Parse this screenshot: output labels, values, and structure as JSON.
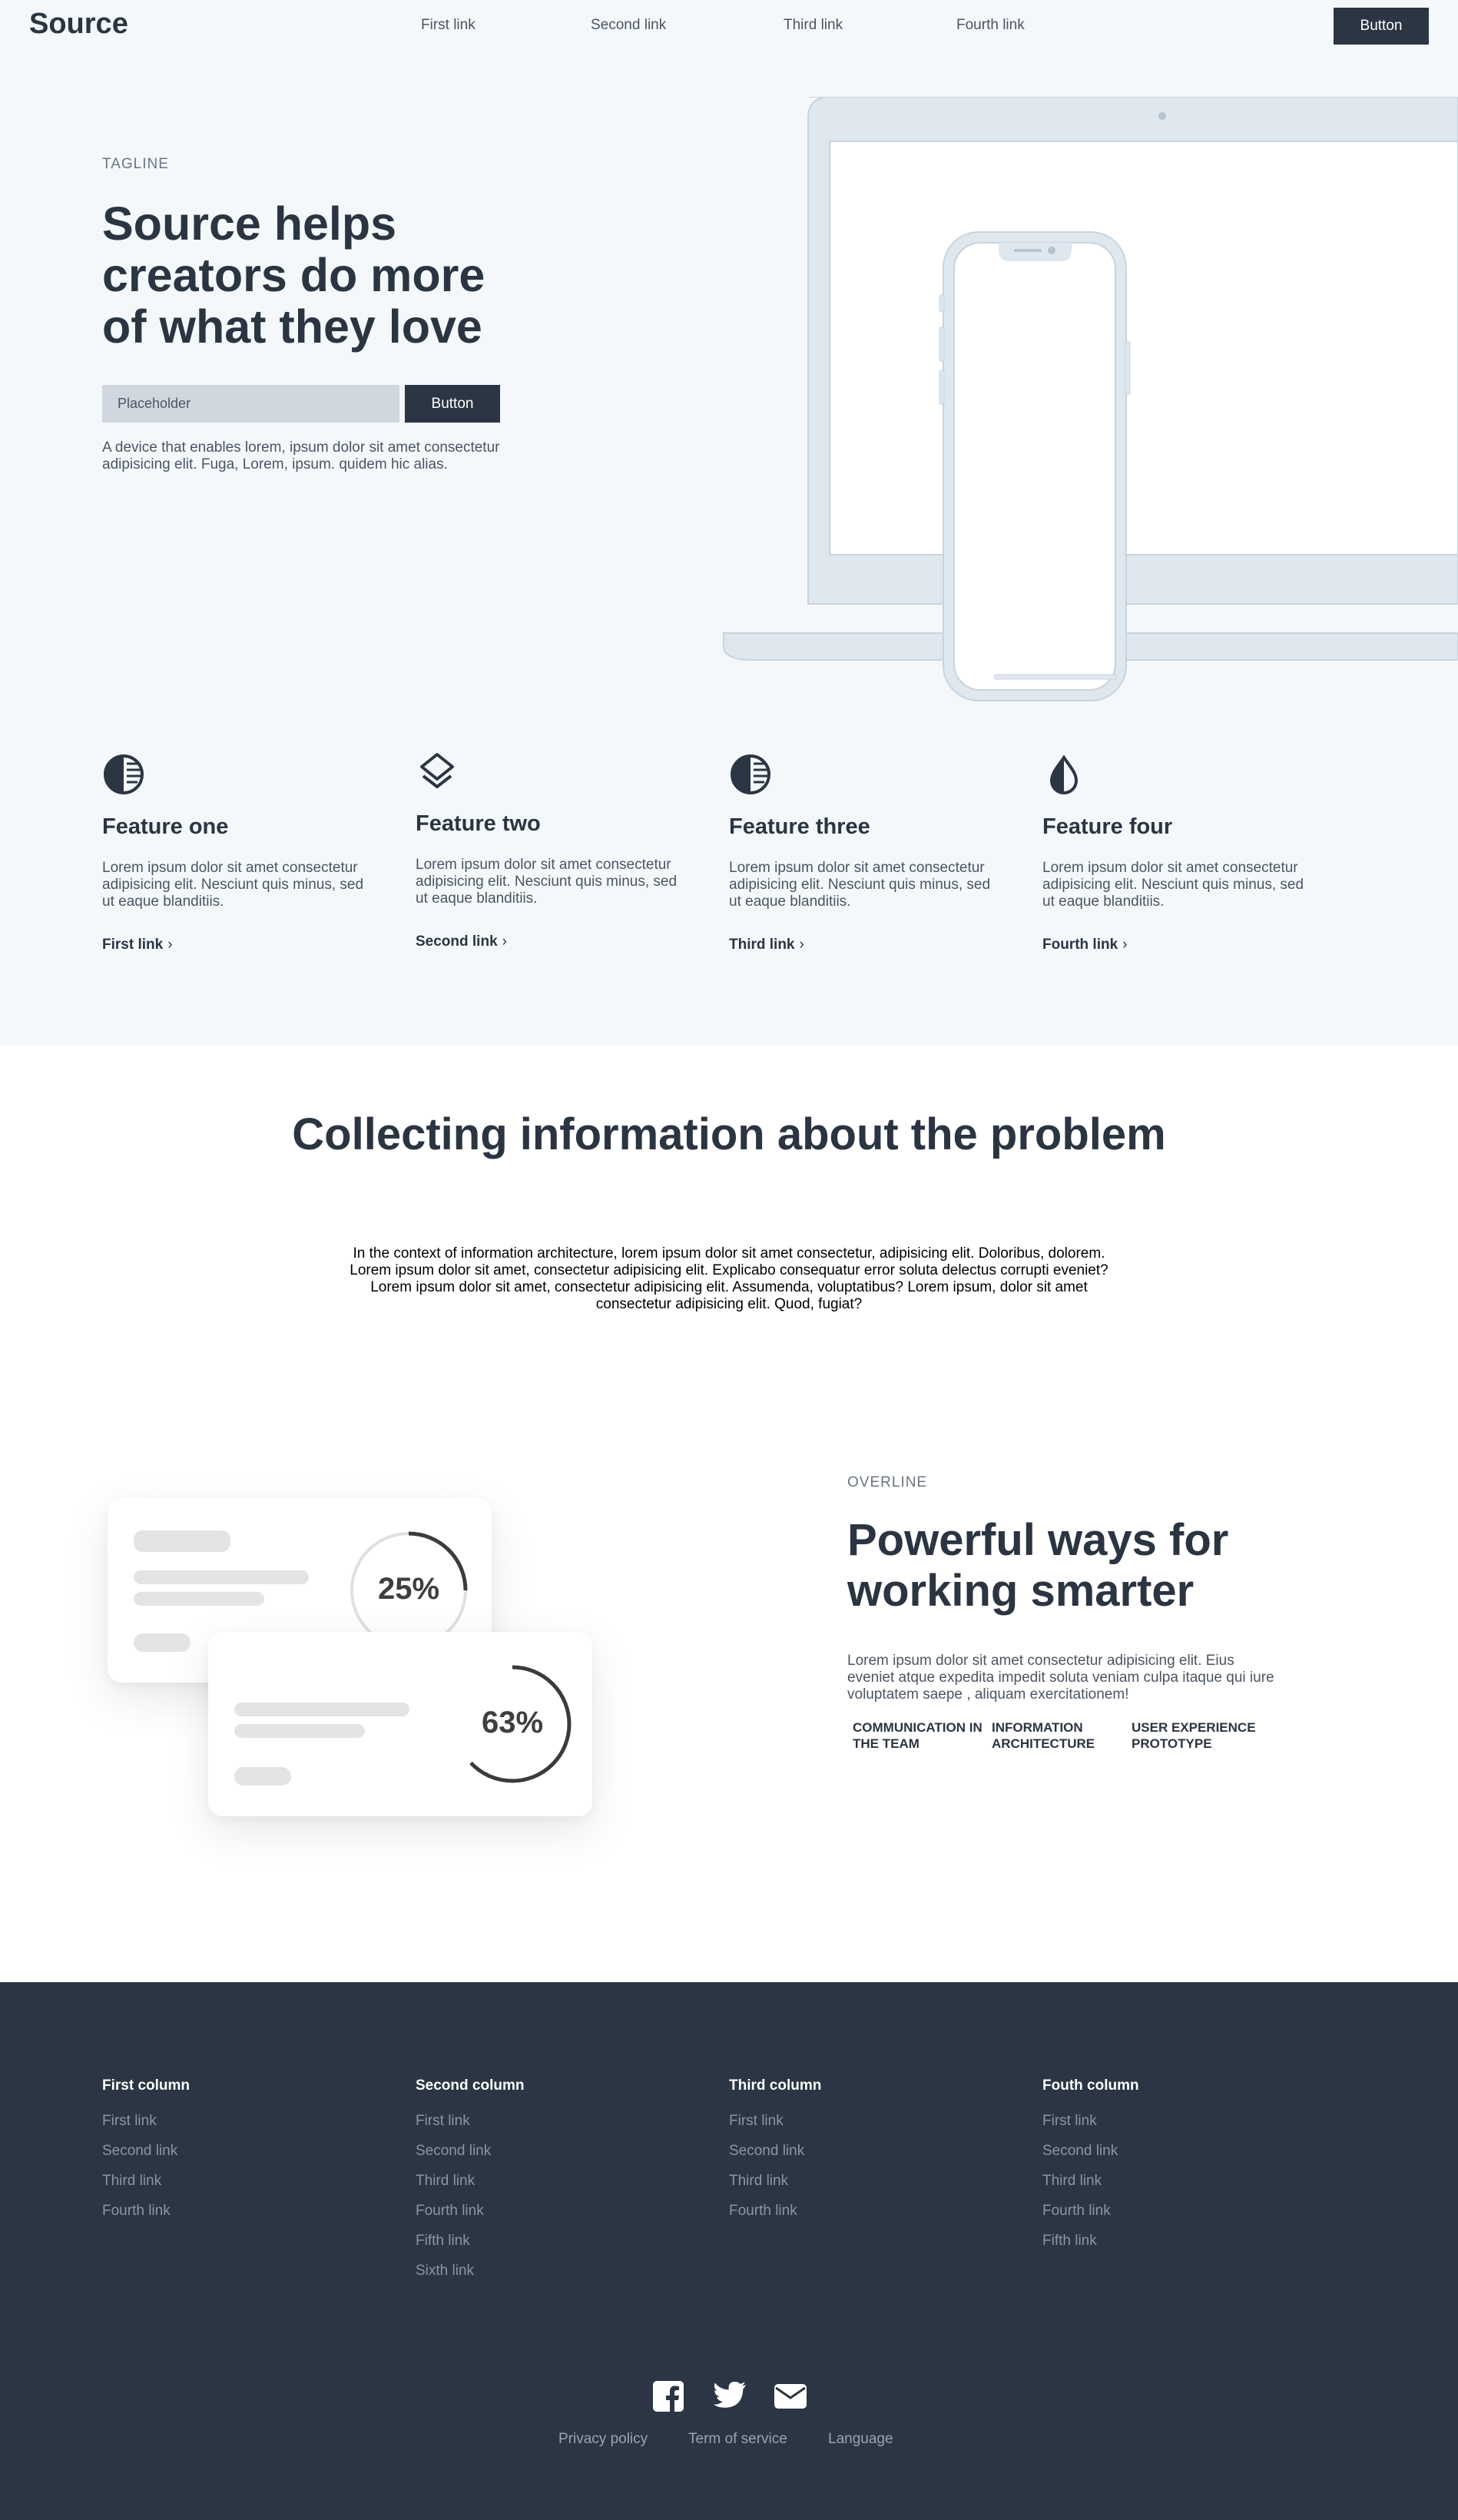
{
  "nav": {
    "logo": "Source",
    "links": [
      "First link",
      "Second link",
      "Third link",
      "Fourth link"
    ],
    "button": "Button"
  },
  "hero": {
    "tagline": "TAGLINE",
    "title": "Source helps creators do more of what they love",
    "input_placeholder": "Placeholder",
    "button": "Button",
    "description": "A device that enables lorem, ipsum dolor sit amet consectetur adipisicing elit. Fuga, Lorem, ipsum. quidem hic alias."
  },
  "features": [
    {
      "icon": "contrast-circle-icon",
      "title": "Feature one",
      "text": "Lorem ipsum dolor sit amet consectetur adipisicing elit. Nesciunt quis minus, sed ut eaque blanditiis.",
      "link": "First link"
    },
    {
      "icon": "layers-icon",
      "title": "Feature two",
      "text": "Lorem ipsum dolor sit amet consectetur adipisicing elit. Nesciunt quis minus, sed ut eaque blanditiis.",
      "link": "Second link"
    },
    {
      "icon": "contrast-circle-icon",
      "title": "Feature three",
      "text": "Lorem ipsum dolor sit amet consectetur adipisicing elit. Nesciunt quis minus, sed ut eaque blanditiis.",
      "link": "Third link"
    },
    {
      "icon": "drop-half-icon",
      "title": "Feature four",
      "text": "Lorem ipsum dolor sit amet consectetur adipisicing elit. Nesciunt quis minus, sed ut eaque blanditiis.",
      "link": "Fourth link"
    }
  ],
  "collect": {
    "title": "Collecting information about the problem",
    "text": "In the context of information architecture, lorem ipsum dolor sit amet consectetur, adipisicing elit. Doloribus, dolorem. Lorem ipsum dolor sit amet, consectetur adipisicing elit. Explicabo consequatur error soluta delectus corrupti eveniet? Lorem ipsum dolor sit amet, consectetur adipisicing elit. Assumenda, voluptatibus? Lorem ipsum, dolor sit amet consectetur adipisicing elit. Quod, fugiat?"
  },
  "power": {
    "overline": "OVERLINE",
    "title": "Powerful ways for working smarter",
    "text": "Lorem ipsum dolor sit amet consectetur adipisicing elit. Eius eveniet atque expedita impedit soluta veniam culpa itaque qui iure voluptatem saepe , aliquam exercitationem!",
    "tags": [
      "COMMUNICATION IN THE TEAM",
      "INFORMATION ARCHITECTURE",
      "USER EXPERIENCE PROTOTYPE"
    ],
    "cards": [
      {
        "label": "25%",
        "progress": 0.25
      },
      {
        "label": "63%",
        "progress": 0.63
      }
    ]
  },
  "footer": {
    "columns": [
      {
        "title": "First column",
        "links": [
          "First link",
          "Second link",
          "Third link",
          "Fourth link"
        ]
      },
      {
        "title": "Second column",
        "links": [
          "First link",
          "Second link",
          "Third link",
          "Fourth link",
          "Fifth link",
          "Sixth link"
        ]
      },
      {
        "title": "Third column",
        "links": [
          "First link",
          "Second link",
          "Third link",
          "Fourth link"
        ]
      },
      {
        "title": "Fouth column",
        "links": [
          "First link",
          "Second link",
          "Third link",
          "Fourth link",
          "Fifth link"
        ]
      }
    ],
    "social": [
      "facebook-icon",
      "twitter-icon",
      "mail-icon"
    ],
    "legal": [
      "Privacy policy",
      "Term of service",
      "Language"
    ]
  },
  "colors": {
    "dark": "#2b3543",
    "light_bg": "#f4f8fb",
    "muted_text": "#4a5563",
    "footer_link": "#8b95a3"
  }
}
